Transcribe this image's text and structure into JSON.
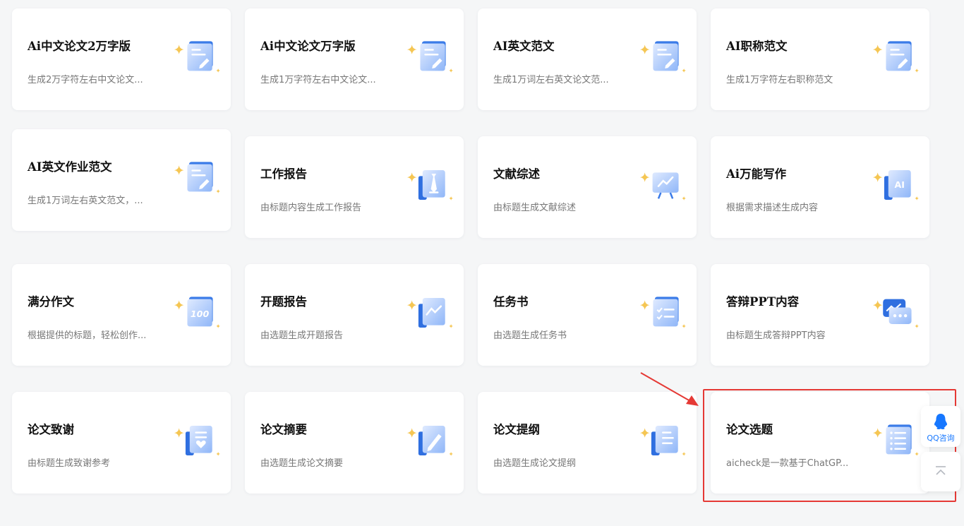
{
  "cards": [
    {
      "title": "Ai中文论文2万字版",
      "desc": "生成2万字符左右中文论文..."
    },
    {
      "title": "Ai中文论文万字版",
      "desc": "生成1万字符左右中文论文..."
    },
    {
      "title": "AI英文范文",
      "desc": "生成1万词左右英文论文范..."
    },
    {
      "title": "AI职称范文",
      "desc": "生成1万字符左右职称范文"
    },
    {
      "title": "AI英文作业范文",
      "desc": "生成1万词左右英文范文，..."
    },
    {
      "title": "工作报告",
      "desc": "由标题内容生成工作报告"
    },
    {
      "title": "文献综述",
      "desc": "由标题生成文献综述"
    },
    {
      "title": "Ai万能写作",
      "desc": "根据需求描述生成内容"
    },
    {
      "title": "满分作文",
      "desc": "根据提供的标题，轻松创作..."
    },
    {
      "title": "开题报告",
      "desc": "由选题生成开题报告"
    },
    {
      "title": "任务书",
      "desc": "由选题生成任务书"
    },
    {
      "title": "答辩PPT内容",
      "desc": "由标题生成答辩PPT内容"
    },
    {
      "title": "论文致谢",
      "desc": "由标题生成致谢参考"
    },
    {
      "title": "论文摘要",
      "desc": "由选题生成论文摘要"
    },
    {
      "title": "论文提纲",
      "desc": "由选题生成论文提纲"
    },
    {
      "title": "论文选题",
      "desc": "aicheck是一款基于ChatGP..."
    }
  ],
  "icons": [
    "document-pen-icon",
    "document-pen-icon",
    "document-pen-icon",
    "document-pen-icon",
    "document-pen-icon",
    "tie-report-icon",
    "chart-board-icon",
    "ai-write-icon",
    "score-100-icon",
    "opening-report-chart-icon",
    "task-checklist-icon",
    "ppt-chat-icon",
    "thanks-heart-icon",
    "abstract-pen-icon",
    "outline-doc-icon",
    "topic-list-icon"
  ],
  "float": {
    "qq_label": "QQ咨询"
  },
  "icon_texts": {
    "ai": "AI",
    "score": "100"
  },
  "colors": {
    "accent": "#4a8af4",
    "icon_light": "#c9ddff",
    "icon_dark": "#2f6fe0",
    "sparkle": "#f5c653",
    "annotation": "#e53935"
  }
}
